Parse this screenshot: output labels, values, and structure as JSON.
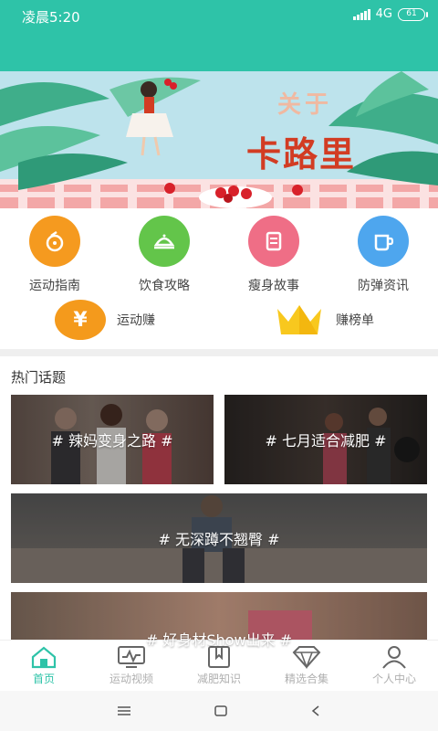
{
  "status_bar": {
    "time": "凌晨5:20",
    "network": "4G",
    "battery": "61"
  },
  "banner": {
    "title_small": "关于",
    "title_big": "卡路里"
  },
  "categories": [
    {
      "label": "运动指南",
      "icon": "sport-guide-icon",
      "color": "#f59a1f"
    },
    {
      "label": "饮食攻略",
      "icon": "food-tray-icon",
      "color": "#63c54a"
    },
    {
      "label": "瘦身故事",
      "icon": "notebook-icon",
      "color": "#ef6e86"
    },
    {
      "label": "防弹资讯",
      "icon": "cup-icon",
      "color": "#4ea6ee"
    }
  ],
  "earn": {
    "left": {
      "label": "运动赚",
      "symbol": "¥"
    },
    "right": {
      "label": "赚榜单"
    }
  },
  "hot_topics": {
    "title": "热门话题",
    "items": [
      "# 辣妈变身之路 #",
      "# 七月适合减肥 #",
      "# 无深蹲不翘臀 #",
      "# 好身材Show出来 #"
    ]
  },
  "tabs": [
    {
      "label": "首页",
      "icon": "home-icon",
      "active": true
    },
    {
      "label": "运动视频",
      "icon": "video-monitor-icon",
      "active": false
    },
    {
      "label": "减肥知识",
      "icon": "book-icon",
      "active": false
    },
    {
      "label": "精选合集",
      "icon": "diamond-icon",
      "active": false
    },
    {
      "label": "个人中心",
      "icon": "person-icon",
      "active": false
    }
  ],
  "colors": {
    "accent": "#2ec3a8"
  }
}
